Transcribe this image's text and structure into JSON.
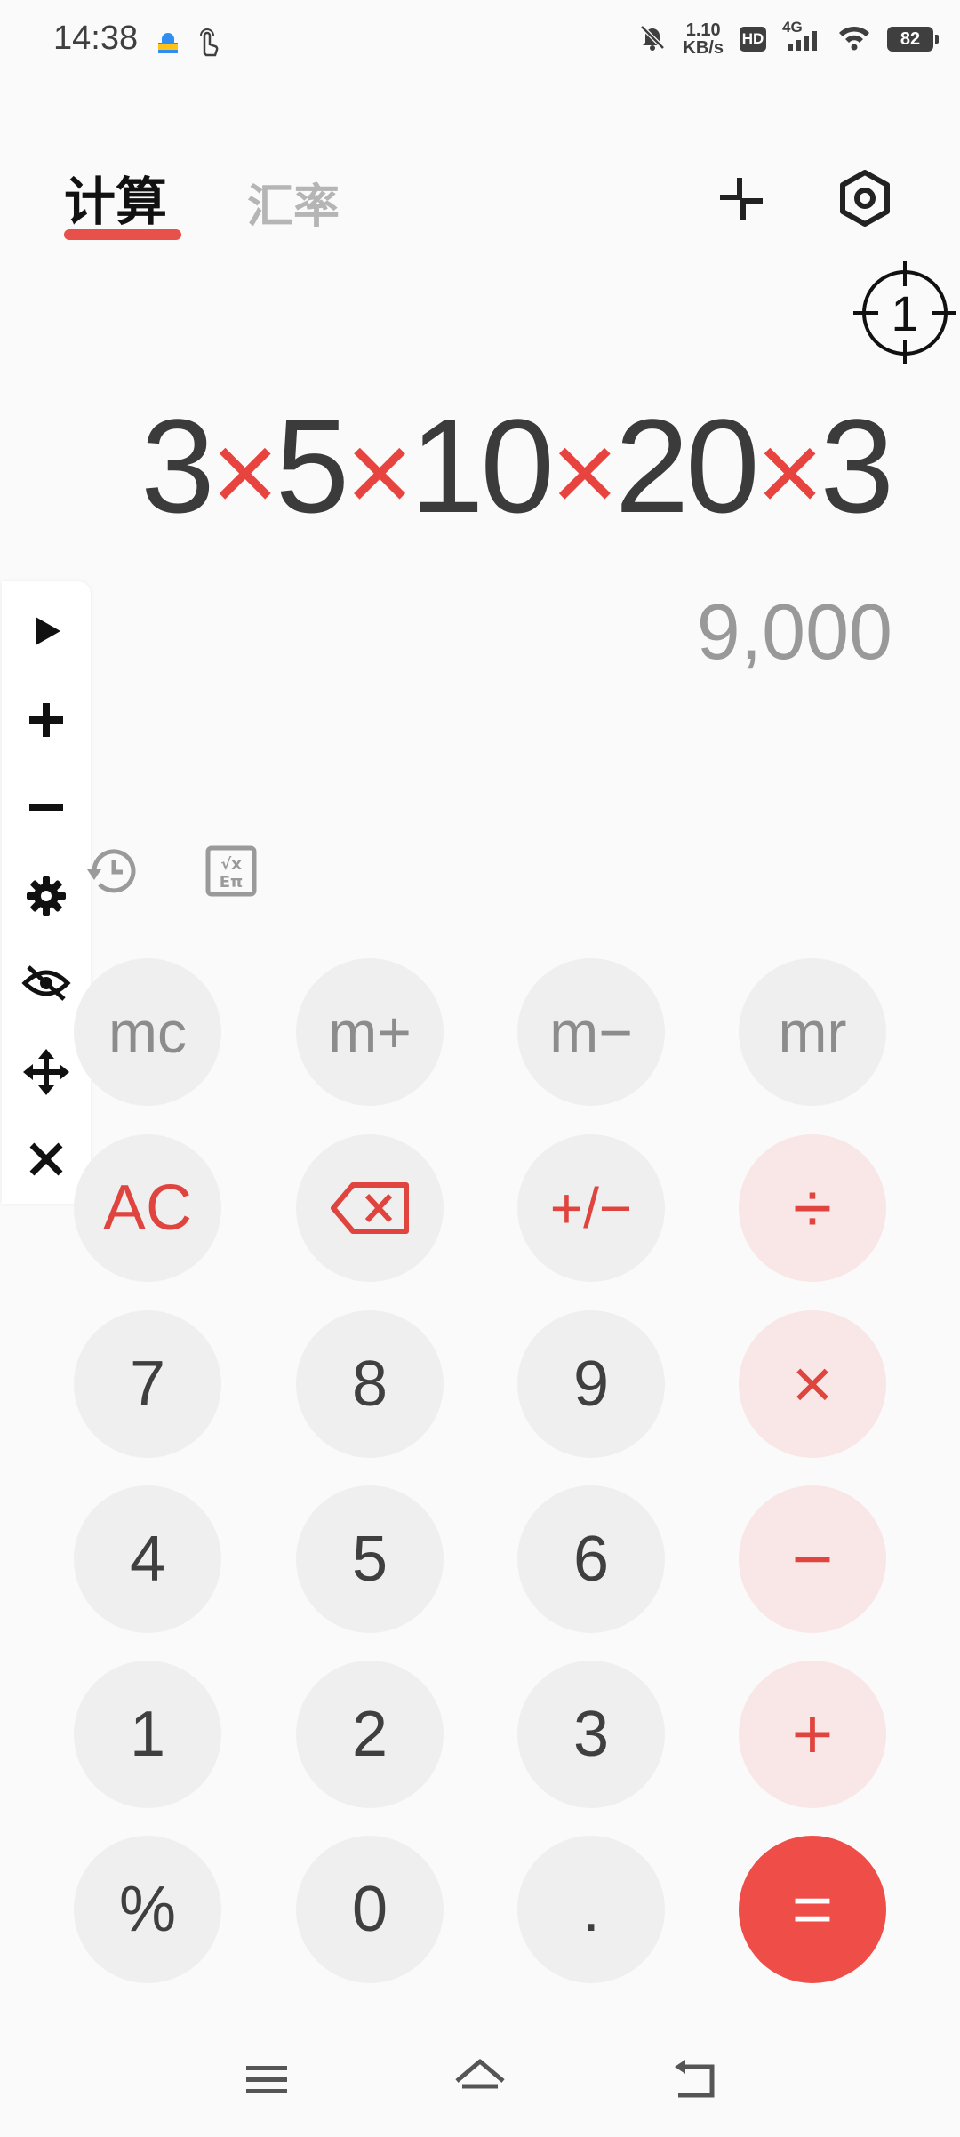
{
  "status_bar": {
    "time": "14:38",
    "speed_value": "1.10",
    "speed_unit": "KB/s",
    "hd_badge": "HD",
    "network": "4G",
    "battery": "82"
  },
  "tabs": {
    "active": "计算",
    "inactive": "汇率"
  },
  "overlay": {
    "crosshair_number": "1"
  },
  "display": {
    "expression": [
      {
        "t": "3",
        "op": false
      },
      {
        "t": "×",
        "op": true
      },
      {
        "t": "5",
        "op": false
      },
      {
        "t": "×",
        "op": true
      },
      {
        "t": "10",
        "op": false
      },
      {
        "t": "×",
        "op": true
      },
      {
        "t": "20",
        "op": false
      },
      {
        "t": "×",
        "op": true
      },
      {
        "t": "3",
        "op": false
      }
    ],
    "result": "9,000"
  },
  "keys": {
    "mc": "mc",
    "m_plus": "m+",
    "m_minus": "m−",
    "mr": "mr",
    "ac": "AC",
    "plus_minus": "+/−",
    "divide": "÷",
    "seven": "7",
    "eight": "8",
    "nine": "9",
    "multiply": "×",
    "four": "4",
    "five": "5",
    "six": "6",
    "minus": "−",
    "one": "1",
    "two": "2",
    "three": "3",
    "plus": "+",
    "percent": "%",
    "zero": "0",
    "dot": ".",
    "equals": "="
  },
  "colors": {
    "accent": "#e8504a",
    "key_bg": "#efefef",
    "op_bg": "#f9e6e6",
    "equals_bg": "#ee4d48"
  }
}
